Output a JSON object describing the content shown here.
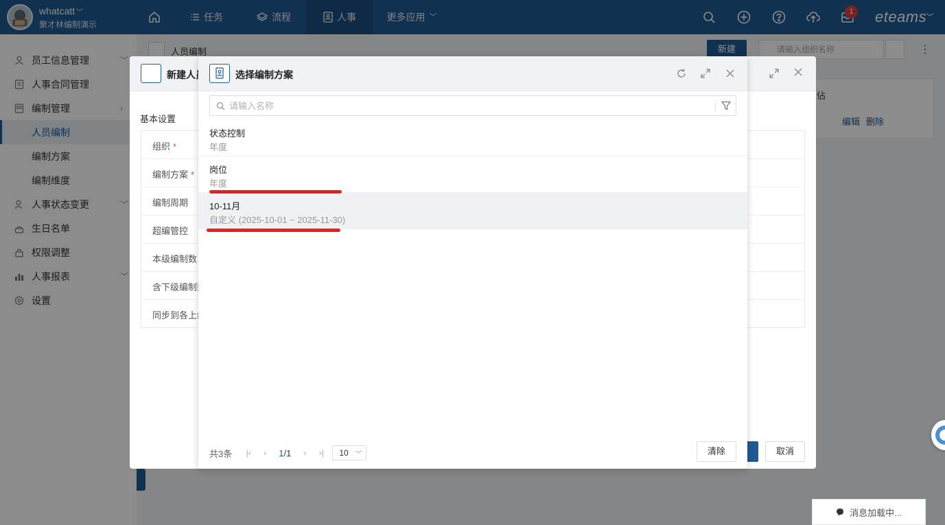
{
  "user": {
    "name": "whatcatt",
    "org": "聚才林编制演示"
  },
  "topnav": {
    "items": [
      {
        "label": "任务"
      },
      {
        "label": "流程"
      },
      {
        "label": "人事"
      },
      {
        "label": "更多应用"
      }
    ],
    "notification_count": "1",
    "brand": "eteams"
  },
  "sidebar": {
    "items": [
      {
        "label": "员工信息管理"
      },
      {
        "label": "人事合同管理"
      },
      {
        "label": "编制管理"
      },
      {
        "label": "人员编制"
      },
      {
        "label": "编制方案"
      },
      {
        "label": "编制维度"
      },
      {
        "label": "人事状态变更"
      },
      {
        "label": "生日名单"
      },
      {
        "label": "权限调整"
      },
      {
        "label": "人事报表"
      },
      {
        "label": "设置"
      }
    ]
  },
  "page": {
    "breadcrumb": "人员编制",
    "new_button": "新建",
    "search_placeholder": "请输入组织名称",
    "table_header_partial": "佔",
    "edit_link": "编辑",
    "delete_link": "删除",
    "message_loading": "消息加载中..."
  },
  "dialog_new": {
    "title": "新建人员",
    "section": "基本设置",
    "fields": [
      {
        "label": "组织",
        "required": true
      },
      {
        "label": "编制方案",
        "required": true
      },
      {
        "label": "编制周期",
        "required": false
      },
      {
        "label": "超编管控",
        "required": false
      },
      {
        "label": "本级编制数",
        "required": true
      },
      {
        "label": "含下级编制数",
        "required": false
      },
      {
        "label": "同步到各上级",
        "required": false
      }
    ],
    "cancel_button": "取消"
  },
  "dialog_select": {
    "title": "选择编制方案",
    "search_placeholder": "请输入名称",
    "items": [
      {
        "name": "状态控制",
        "period": "年度"
      },
      {
        "name": "岗位",
        "period": "年度"
      },
      {
        "name": "10-11月",
        "period": "自定义 (2025-10-01 ~ 2025-11-30)"
      }
    ],
    "pager": {
      "total": "共3条",
      "current": "1",
      "pages": "/1",
      "page_size": "10"
    },
    "clear_button": "清除"
  },
  "colors": {
    "primary": "#1f5a94",
    "annotation_red": "#e82020",
    "badge_red": "#e23c3c"
  }
}
